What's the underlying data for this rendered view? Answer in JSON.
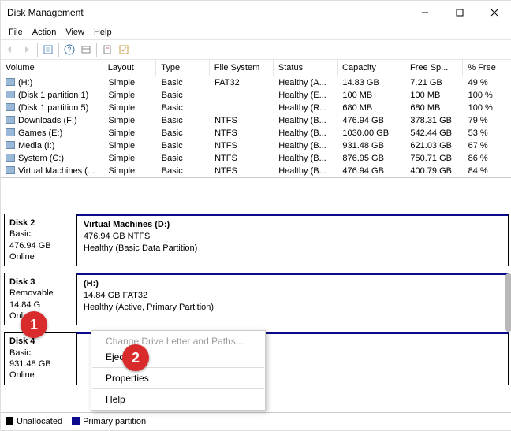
{
  "window": {
    "title": "Disk Management"
  },
  "menu": [
    "File",
    "Action",
    "View",
    "Help"
  ],
  "columns": [
    "Volume",
    "Layout",
    "Type",
    "File System",
    "Status",
    "Capacity",
    "Free Sp...",
    "% Free"
  ],
  "volumes": [
    {
      "name": "(H:)",
      "layout": "Simple",
      "type": "Basic",
      "fs": "FAT32",
      "status": "Healthy (A...",
      "cap": "14.83 GB",
      "free": "7.21 GB",
      "pct": "49 %"
    },
    {
      "name": "(Disk 1 partition 1)",
      "layout": "Simple",
      "type": "Basic",
      "fs": "",
      "status": "Healthy (E...",
      "cap": "100 MB",
      "free": "100 MB",
      "pct": "100 %"
    },
    {
      "name": "(Disk 1 partition 5)",
      "layout": "Simple",
      "type": "Basic",
      "fs": "",
      "status": "Healthy (R...",
      "cap": "680 MB",
      "free": "680 MB",
      "pct": "100 %"
    },
    {
      "name": "Downloads (F:)",
      "layout": "Simple",
      "type": "Basic",
      "fs": "NTFS",
      "status": "Healthy (B...",
      "cap": "476.94 GB",
      "free": "378.31 GB",
      "pct": "79 %"
    },
    {
      "name": "Games (E:)",
      "layout": "Simple",
      "type": "Basic",
      "fs": "NTFS",
      "status": "Healthy (B...",
      "cap": "1030.00 GB",
      "free": "542.44 GB",
      "pct": "53 %"
    },
    {
      "name": "Media (I:)",
      "layout": "Simple",
      "type": "Basic",
      "fs": "NTFS",
      "status": "Healthy (B...",
      "cap": "931.48 GB",
      "free": "621.03 GB",
      "pct": "67 %"
    },
    {
      "name": "System (C:)",
      "layout": "Simple",
      "type": "Basic",
      "fs": "NTFS",
      "status": "Healthy (B...",
      "cap": "876.95 GB",
      "free": "750.71 GB",
      "pct": "86 %"
    },
    {
      "name": "Virtual Machines (...",
      "layout": "Simple",
      "type": "Basic",
      "fs": "NTFS",
      "status": "Healthy (B...",
      "cap": "476.94 GB",
      "free": "400.79 GB",
      "pct": "84 %"
    }
  ],
  "disks": [
    {
      "name": "Disk 2",
      "kind": "Basic",
      "size": "476.94 GB",
      "state": "Online",
      "part": {
        "title": "Virtual Machines  (D:)",
        "sub": "476.94 GB NTFS",
        "stat": "Healthy (Basic Data Partition)"
      }
    },
    {
      "name": "Disk 3",
      "kind": "Removable",
      "size": "14.84 G",
      "state": "Onlin",
      "part": {
        "title": "(H:)",
        "sub": "14.84 GB FAT32",
        "stat": "Healthy (Active, Primary Partition)"
      }
    },
    {
      "name": "Disk 4",
      "kind": "Basic",
      "size": "931.48 GB",
      "state": "Online",
      "part": {
        "title": "",
        "sub": "",
        "stat": ""
      }
    }
  ],
  "context": {
    "change": "Change Drive Letter and Paths...",
    "eject": "Eject",
    "properties": "Properties",
    "help": "Help"
  },
  "legend": {
    "unalloc": "Unallocated",
    "primary": "Primary partition"
  },
  "markers": {
    "m1": "1",
    "m2": "2"
  }
}
